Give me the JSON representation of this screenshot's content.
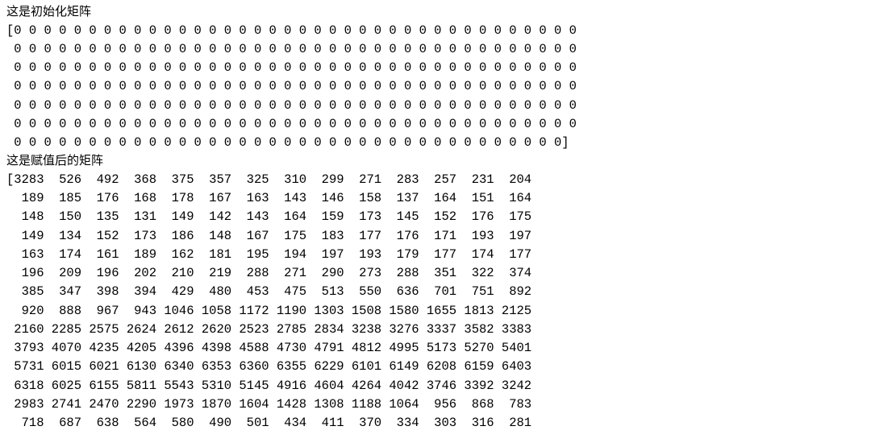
{
  "label_init": "这是初始化矩阵",
  "label_assigned": "这是赋值后的矩阵",
  "init_cols": 38,
  "init_rows": 7,
  "init_last_cols": 37,
  "chart_data": {
    "type": "table",
    "title": "Matrix after assignment",
    "columns": 14,
    "rows": [
      [
        3283,
        526,
        492,
        368,
        375,
        357,
        325,
        310,
        299,
        271,
        283,
        257,
        231,
        204
      ],
      [
        189,
        185,
        176,
        168,
        178,
        167,
        163,
        143,
        146,
        158,
        137,
        164,
        151,
        164
      ],
      [
        148,
        150,
        135,
        131,
        149,
        142,
        143,
        164,
        159,
        173,
        145,
        152,
        176,
        175
      ],
      [
        149,
        134,
        152,
        173,
        186,
        148,
        167,
        175,
        183,
        177,
        176,
        171,
        193,
        197
      ],
      [
        163,
        174,
        161,
        189,
        162,
        181,
        195,
        194,
        197,
        193,
        179,
        177,
        174,
        177
      ],
      [
        196,
        209,
        196,
        202,
        210,
        219,
        288,
        271,
        290,
        273,
        288,
        351,
        322,
        374
      ],
      [
        385,
        347,
        398,
        394,
        429,
        480,
        453,
        475,
        513,
        550,
        636,
        701,
        751,
        892
      ],
      [
        920,
        888,
        967,
        943,
        1046,
        1058,
        1172,
        1190,
        1303,
        1508,
        1580,
        1655,
        1813,
        2125
      ],
      [
        2160,
        2285,
        2575,
        2624,
        2612,
        2620,
        2523,
        2785,
        2834,
        3238,
        3276,
        3337,
        3582,
        3383
      ],
      [
        3793,
        4070,
        4235,
        4205,
        4396,
        4398,
        4588,
        4730,
        4791,
        4812,
        4995,
        5173,
        5270,
        5401
      ],
      [
        5731,
        6015,
        6021,
        6130,
        6340,
        6353,
        6360,
        6355,
        6229,
        6101,
        6149,
        6208,
        6159,
        6403
      ],
      [
        6318,
        6025,
        6155,
        5811,
        5543,
        5310,
        5145,
        4916,
        4604,
        4264,
        4042,
        3746,
        3392,
        3242
      ],
      [
        2983,
        2741,
        2470,
        2290,
        1973,
        1870,
        1604,
        1428,
        1308,
        1188,
        1064,
        956,
        868,
        783
      ],
      [
        718,
        687,
        638,
        564,
        580,
        490,
        501,
        434,
        411,
        370,
        334,
        303,
        316,
        281
      ]
    ]
  }
}
